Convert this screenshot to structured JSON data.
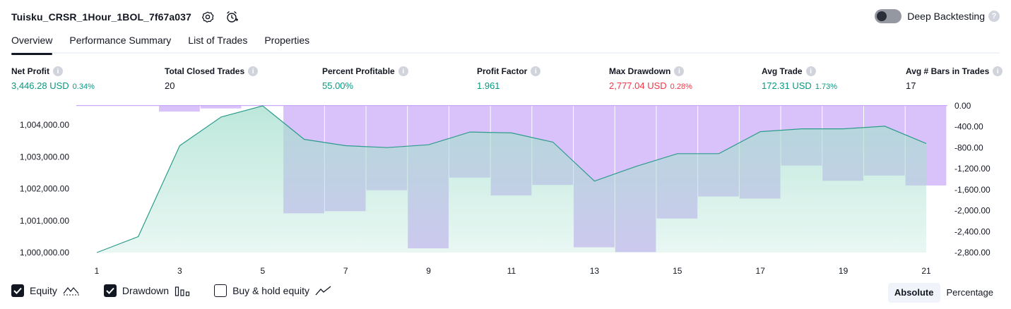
{
  "header": {
    "strategy_name": "Tuisku_CRSR_1Hour_1BOL_7f67a037",
    "settings_icon": "gear-icon",
    "alert_icon": "alarm-clock-plus-icon",
    "deep_backtesting_label": "Deep Backtesting",
    "deep_backtesting_enabled": false,
    "help_glyph": "?"
  },
  "tabs": [
    {
      "label": "Overview",
      "active": true
    },
    {
      "label": "Performance Summary",
      "active": false
    },
    {
      "label": "List of Trades",
      "active": false
    },
    {
      "label": "Properties",
      "active": false
    }
  ],
  "stats": [
    {
      "label": "Net Profit",
      "value": "3,446.28 USD",
      "pct": "0.34%",
      "color": "#089981"
    },
    {
      "label": "Total Closed Trades",
      "value": "20",
      "pct": "",
      "color": "#131722"
    },
    {
      "label": "Percent Profitable",
      "value": "55.00%",
      "pct": "",
      "color": "#089981"
    },
    {
      "label": "Profit Factor",
      "value": "1.961",
      "pct": "",
      "color": "#089981"
    },
    {
      "label": "Max Drawdown",
      "value": "2,777.04 USD",
      "pct": "0.28%",
      "color": "#f23645"
    },
    {
      "label": "Avg Trade",
      "value": "172.31 USD",
      "pct": "1.73%",
      "color": "#089981"
    },
    {
      "label": "Avg # Bars in Trades",
      "value": "17",
      "pct": "",
      "color": "#131722"
    }
  ],
  "info_glyph": "i",
  "chart_data": {
    "type": "area",
    "x": [
      1,
      2,
      3,
      4,
      5,
      6,
      7,
      8,
      9,
      10,
      11,
      12,
      13,
      14,
      15,
      16,
      17,
      18,
      19,
      20,
      21
    ],
    "x_ticks": [
      1,
      3,
      5,
      7,
      9,
      11,
      13,
      15,
      17,
      19,
      21
    ],
    "series": [
      {
        "name": "Equity",
        "type": "area",
        "axis": "left",
        "color": "#2d9c8c",
        "values": [
          1000000,
          1000500,
          1003350,
          1004250,
          1004600,
          1003550,
          1003350,
          1003290,
          1003380,
          1003780,
          1003750,
          1003460,
          1002240,
          1002700,
          1003100,
          1003100,
          1003790,
          1003880,
          1003880,
          1003960,
          1003420
        ]
      },
      {
        "name": "Drawdown",
        "type": "bar",
        "axis": "right",
        "color": "#c9a6f7",
        "values": [
          0,
          0,
          -110,
          -50,
          0,
          -2050,
          -2010,
          -1610,
          -2720,
          -1370,
          -1710,
          -1510,
          -2700,
          -2790,
          -2150,
          -1730,
          -1770,
          -1140,
          -1430,
          -1330,
          -1520
        ]
      }
    ],
    "y_left": {
      "ticks": [
        "1,000,000.00",
        "1,001,000.00",
        "1,002,000.00",
        "1,003,000.00",
        "1,004,000.00"
      ],
      "tick_values": [
        1000000,
        1001000,
        1002000,
        1003000,
        1004000
      ],
      "range": [
        1000000,
        1004600
      ]
    },
    "y_right": {
      "ticks": [
        "0.00",
        "-400.00",
        "-800.00",
        "-1,200.00",
        "-1,600.00",
        "-2,000.00",
        "-2,400.00",
        "-2,800.00"
      ],
      "tick_values": [
        0,
        -400,
        -800,
        -1200,
        -1600,
        -2000,
        -2400,
        -2800
      ],
      "range": [
        0,
        -2800
      ]
    },
    "grid": false
  },
  "legend": {
    "equity": {
      "label": "Equity",
      "checked": true
    },
    "drawdown": {
      "label": "Drawdown",
      "checked": true
    },
    "buy_hold": {
      "label": "Buy & hold equity",
      "checked": false
    }
  },
  "mode": {
    "absolute": "Absolute",
    "percentage": "Percentage",
    "selected": "Absolute"
  }
}
